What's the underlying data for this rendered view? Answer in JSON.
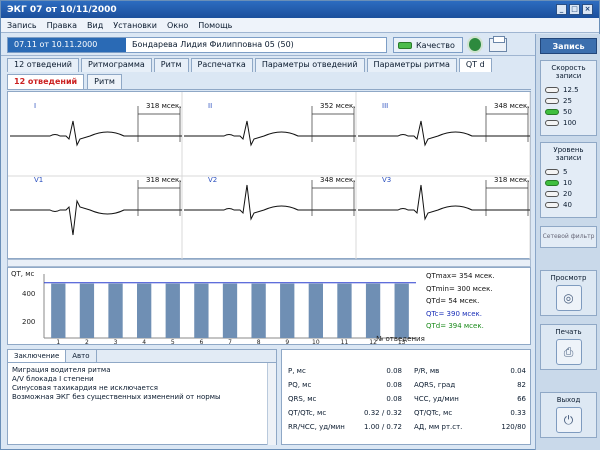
{
  "window": {
    "title": "ЭКГ 07 от 10/11/2000",
    "buttons": [
      "_",
      "□",
      "×"
    ]
  },
  "menu": [
    "Запись",
    "Правка",
    "Вид",
    "Установки",
    "Окно",
    "Помощь"
  ],
  "toolbar": {
    "patient_date": "07.11 от 10.11.2000",
    "patient_name": "Бондарева Лидия Филипповна 05 (50)",
    "quality_label": "Качество",
    "record_icon": "record-icon",
    "print_icon": "printer-icon"
  },
  "tabs": [
    "12 отведений",
    "Ритмограмма",
    "Ритм",
    "Распечатка",
    "Параметры отведений",
    "Параметры ритма",
    "QT d"
  ],
  "active_tab": 6,
  "subtabs": [
    "12 отведений",
    "Ритм"
  ],
  "leads": {
    "row1": [
      {
        "label": "I",
        "ms": "318 мсек."
      },
      {
        "label": "II",
        "ms": "352 мсек."
      },
      {
        "label": "III",
        "ms": "348 мсек."
      }
    ],
    "row2": [
      {
        "label": "V1",
        "ms": "318 мсек."
      },
      {
        "label": "V2",
        "ms": "348 мсек."
      },
      {
        "label": "V3",
        "ms": "318 мсек."
      }
    ]
  },
  "rr": {
    "ylabel": "QT, мс",
    "ticks": [
      "400",
      "200"
    ],
    "x_marks": [
      "1",
      "2",
      "3",
      "4",
      "5",
      "6",
      "7",
      "8",
      "9",
      "10",
      "11",
      "12",
      "13"
    ],
    "x_unit": "№ отведения",
    "stats": [
      {
        "text": "QTmax= 354 мсек.",
        "color": "#111111"
      },
      {
        "text": "QTmin= 300 мсек.",
        "color": "#111111"
      },
      {
        "text": "QTd= 54 мсек.",
        "color": "#111111"
      },
      {
        "text": "QTc= 390 мсек.",
        "color": "#1a2fb8"
      },
      {
        "text": "QTd= 394 мсек.",
        "color": "#1a8a1a"
      }
    ]
  },
  "chart_data": {
    "type": "bar",
    "categories": [
      "1",
      "2",
      "3",
      "4",
      "5",
      "6",
      "7",
      "8",
      "9",
      "10",
      "11",
      "12",
      "13"
    ],
    "values": [
      340,
      340,
      340,
      340,
      340,
      340,
      340,
      340,
      340,
      340,
      340,
      340,
      340
    ],
    "ylim": [
      0,
      400
    ],
    "reference_line": 345,
    "color": "#6f8fb4"
  },
  "comments": {
    "tabs": [
      "Заключение",
      "Авто"
    ],
    "lines": [
      "Миграция водителя ритма",
      "А/V блокада I степени",
      "Синусовая тахикардия не исключается",
      "Возможная ЭКГ без существенных изменений от нормы"
    ]
  },
  "params": {
    "left": [
      {
        "k": "P, мс",
        "v": "0.08"
      },
      {
        "k": "PQ, мс",
        "v": "0.08"
      },
      {
        "k": "QRS, мс",
        "v": "0.08"
      },
      {
        "k": "QT/QTc, мс",
        "v": "0.32 / 0.32"
      },
      {
        "k": "RR/ЧСС, уд/мин",
        "v": "1.00 / 0.72"
      }
    ],
    "right": [
      {
        "k": "P/R, мв",
        "v": "0.04"
      },
      {
        "k": "AQRS, град",
        "v": "82"
      },
      {
        "k": "ЧСС, уд/мин",
        "v": "66"
      },
      {
        "k": "QT/QTc, мс",
        "v": "0.33"
      },
      {
        "k": "АД, мм рт.ст.",
        "v": "120/80"
      }
    ]
  },
  "side": {
    "header": "Запись",
    "speed_title": "Скорость записи",
    "speeds": [
      "12.5",
      "25",
      "50",
      "100"
    ],
    "speed_selected": 2,
    "level_title": "Уровень записи",
    "levels": [
      "5",
      "10",
      "20",
      "40"
    ],
    "level_selected": 1,
    "filter_label": "Сетевой фильтр",
    "btn_view": "Просмотр",
    "btn_print": "Печать",
    "btn_exit": "Выход"
  },
  "colors": {
    "accent": "#2a6ab5",
    "trace": "#111111",
    "grid": "#d8d8d8"
  }
}
